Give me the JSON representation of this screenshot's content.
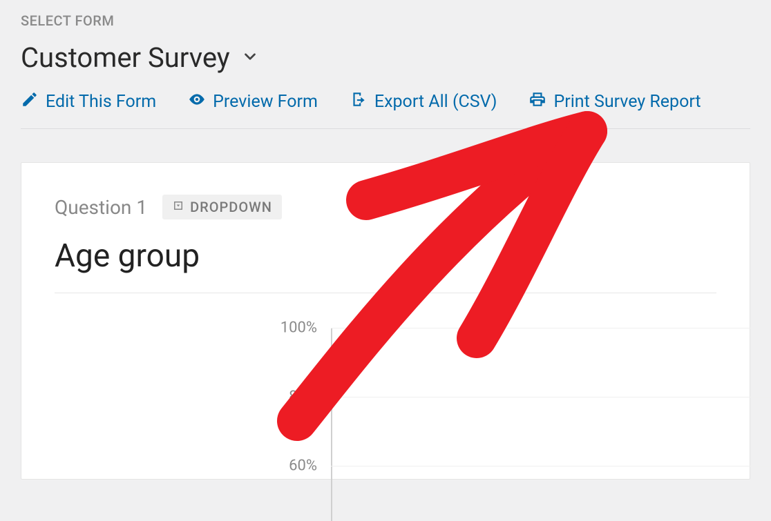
{
  "header": {
    "select_form_label": "SELECT FORM",
    "form_name": "Customer Survey"
  },
  "actions": {
    "edit": "Edit This Form",
    "preview": "Preview Form",
    "export": "Export All (CSV)",
    "print": "Print Survey Report"
  },
  "question": {
    "label": "Question 1",
    "type_badge": "DROPDOWN",
    "title": "Age group"
  },
  "chart_data": {
    "type": "bar",
    "title": "Age group",
    "ylabel": "",
    "ylim": [
      0,
      100
    ],
    "y_ticks": [
      "100%",
      "80%",
      "60%"
    ],
    "categories": [],
    "values": []
  },
  "colors": {
    "link": "#036aab",
    "bg": "#f0f0f1",
    "annotation": "#ed1c24"
  }
}
